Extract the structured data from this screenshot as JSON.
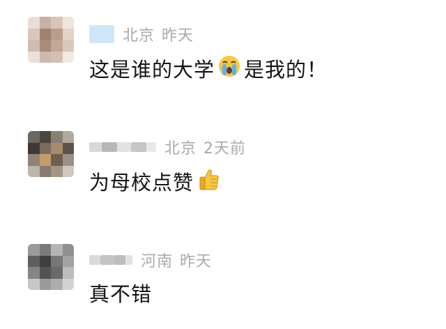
{
  "comments": [
    {
      "location": "北京",
      "time": "昨天",
      "text_before": "这是谁的大学",
      "emoji": "crying-face",
      "text_after": "是我的！"
    },
    {
      "location": "北京",
      "time": "2天前",
      "text_before": "为母校点赞",
      "emoji": "thumbs-up",
      "text_after": ""
    },
    {
      "location": "河南",
      "time": "昨天",
      "text_before": "真不错",
      "emoji": "",
      "text_after": ""
    }
  ]
}
